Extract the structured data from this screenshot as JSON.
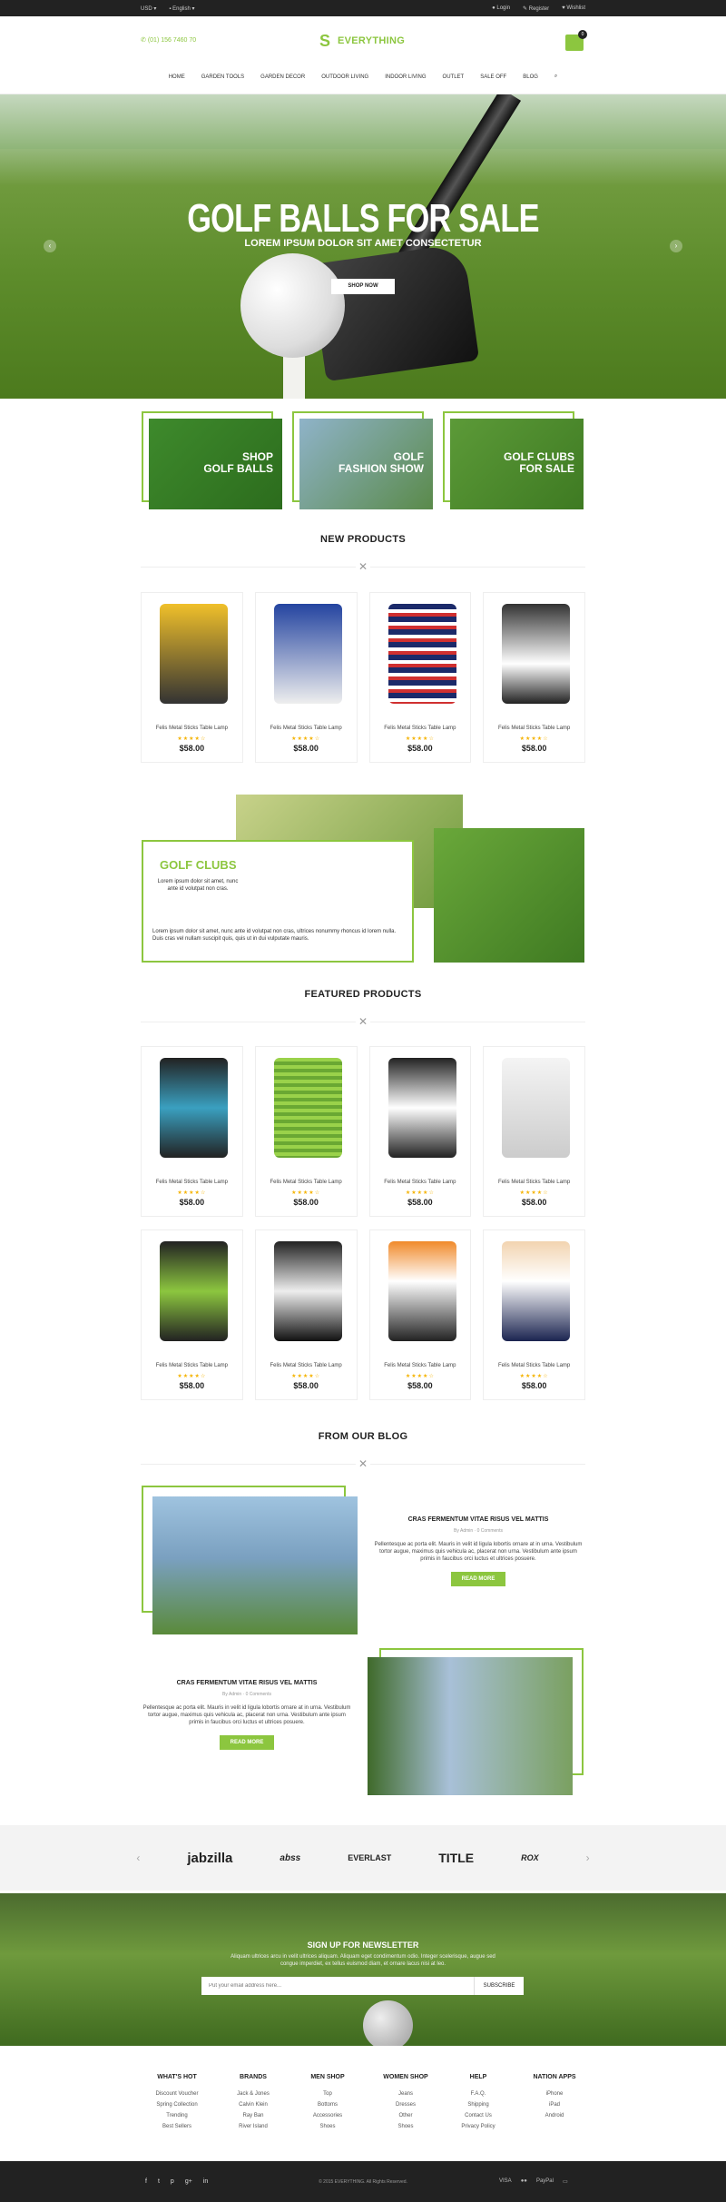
{
  "topbar": {
    "currency": "USD",
    "language": "English",
    "login": "Login",
    "register": "Register",
    "wishlist": "Wishlist"
  },
  "header": {
    "phone": "(01) 156 7460 70",
    "logo_text": "EVERYTHING",
    "cart_count": "0"
  },
  "nav": [
    "HOME",
    "GARDEN TOOLS",
    "GARDEN DECOR",
    "OUTDOOR LIVING",
    "INDOOR LIVING",
    "OUTLET",
    "SALE OFF",
    "BLOG"
  ],
  "hero": {
    "title": "GOLF BALLS FOR SALE",
    "subtitle": "LOREM IPSUM DOLOR SIT AMET CONSECTETUR",
    "button": "SHOP NOW"
  },
  "banners": [
    {
      "line1": "SHOP",
      "line2": "GOLF BALLS"
    },
    {
      "line1": "GOLF",
      "line2": "FASHION SHOW"
    },
    {
      "line1": "GOLF CLUBS",
      "line2": "FOR SALE"
    }
  ],
  "new_products": {
    "title": "NEW PRODUCTS",
    "items": [
      {
        "name": "Felis Metal Sticks Table Lamp",
        "price": "$58.00",
        "rating": 4
      },
      {
        "name": "Felis Metal Sticks Table Lamp",
        "price": "$58.00",
        "rating": 4
      },
      {
        "name": "Felis Metal Sticks Table Lamp",
        "price": "$58.00",
        "rating": 4
      },
      {
        "name": "Felis Metal Sticks Table Lamp",
        "price": "$58.00",
        "rating": 4
      }
    ]
  },
  "golf_clubs": {
    "title": "GOLF CLUBS",
    "text1": "Lorem ipsum dolor sit amet, nunc ante id volutpat non cras.",
    "text2": "Lorem ipsum dolor sit amet, nunc ante id volutpat non cras, ultrices nonummy rhoncus id lorem nulla. Duis cras vel nullam suscipit quis, quis ut in dui vulputate mauris."
  },
  "featured": {
    "title": "FEATURED PRODUCTS",
    "items": [
      {
        "name": "Felis Metal Sticks Table Lamp",
        "price": "$58.00"
      },
      {
        "name": "Felis Metal Sticks Table Lamp",
        "price": "$58.00"
      },
      {
        "name": "Felis Metal Sticks Table Lamp",
        "price": "$58.00"
      },
      {
        "name": "Felis Metal Sticks Table Lamp",
        "price": "$58.00"
      },
      {
        "name": "Felis Metal Sticks Table Lamp",
        "price": "$58.00"
      },
      {
        "name": "Felis Metal Sticks Table Lamp",
        "price": "$58.00"
      },
      {
        "name": "Felis Metal Sticks Table Lamp",
        "price": "$58.00"
      },
      {
        "name": "Felis Metal Sticks Table Lamp",
        "price": "$58.00"
      }
    ]
  },
  "blog": {
    "title": "FROM OUR BLOG",
    "posts": [
      {
        "title": "CRAS FERMENTUM VITAE RISUS VEL MATTIS",
        "author": "By Admin",
        "comments": "0 Comments",
        "text": "Pellentesque ac porta elit. Mauris in velit id ligula lobortis ornare at in urna. Vestibulum tortor augue, maximus quis vehicula ac, placerat non urna. Vestibulum ante ipsum primis in faucibus orci luctus et ultrices posuere.",
        "button": "READ MORE"
      },
      {
        "title": "CRAS FERMENTUM VITAE RISUS VEL MATTIS",
        "author": "By Admin",
        "comments": "0 Comments",
        "text": "Pellentesque ac porta elit. Mauris in velit id ligula lobortis ornare at in urna. Vestibulum tortor augue, maximus quis vehicula ac, placerat non urna. Vestibulum ante ipsum primis in faucibus orci luctus et ultrices posuere.",
        "button": "READ MORE"
      }
    ]
  },
  "brands": [
    "jabzilla",
    "abss",
    "EVERLAST",
    "TITLE",
    "ROX"
  ],
  "newsletter": {
    "title": "SIGN UP FOR NEWSLETTER",
    "text": "Aliquam ultrices arcu in velit ultrices aliquam. Aliquam eget condimentum odio. Integer scelerisque, augue sed congue imperdiet, ex tellus euismod diam, et ornare lacus nisi at leo.",
    "placeholder": "Put your email address here...",
    "button": "SUBSCRIBE"
  },
  "footer": {
    "cols": [
      {
        "title": "WHAT'S HOT",
        "items": [
          "Discount Voucher",
          "Spring Collection",
          "Trending",
          "Best Sellers"
        ]
      },
      {
        "title": "BRANDS",
        "items": [
          "Jack & Jones",
          "Calvin Klein",
          "Ray Ban",
          "River Island"
        ]
      },
      {
        "title": "MEN SHOP",
        "items": [
          "Top",
          "Bottoms",
          "Accessories",
          "Shoes"
        ]
      },
      {
        "title": "WOMEN SHOP",
        "items": [
          "Jeans",
          "Dresses",
          "Other",
          "Shoes"
        ]
      },
      {
        "title": "HELP",
        "items": [
          "F.A.Q.",
          "Shipping",
          "Contact Us",
          "Privacy Policy"
        ]
      },
      {
        "title": "NATION APPS",
        "items": [
          "iPhone",
          "iPad",
          "Android"
        ]
      }
    ],
    "copyright": "© 2015 EVERYTHING. All Rights Reserved.",
    "payments": [
      "VISA",
      "PayPal"
    ]
  },
  "colors": {
    "accent": "#8cc63f",
    "dark": "#222222"
  }
}
